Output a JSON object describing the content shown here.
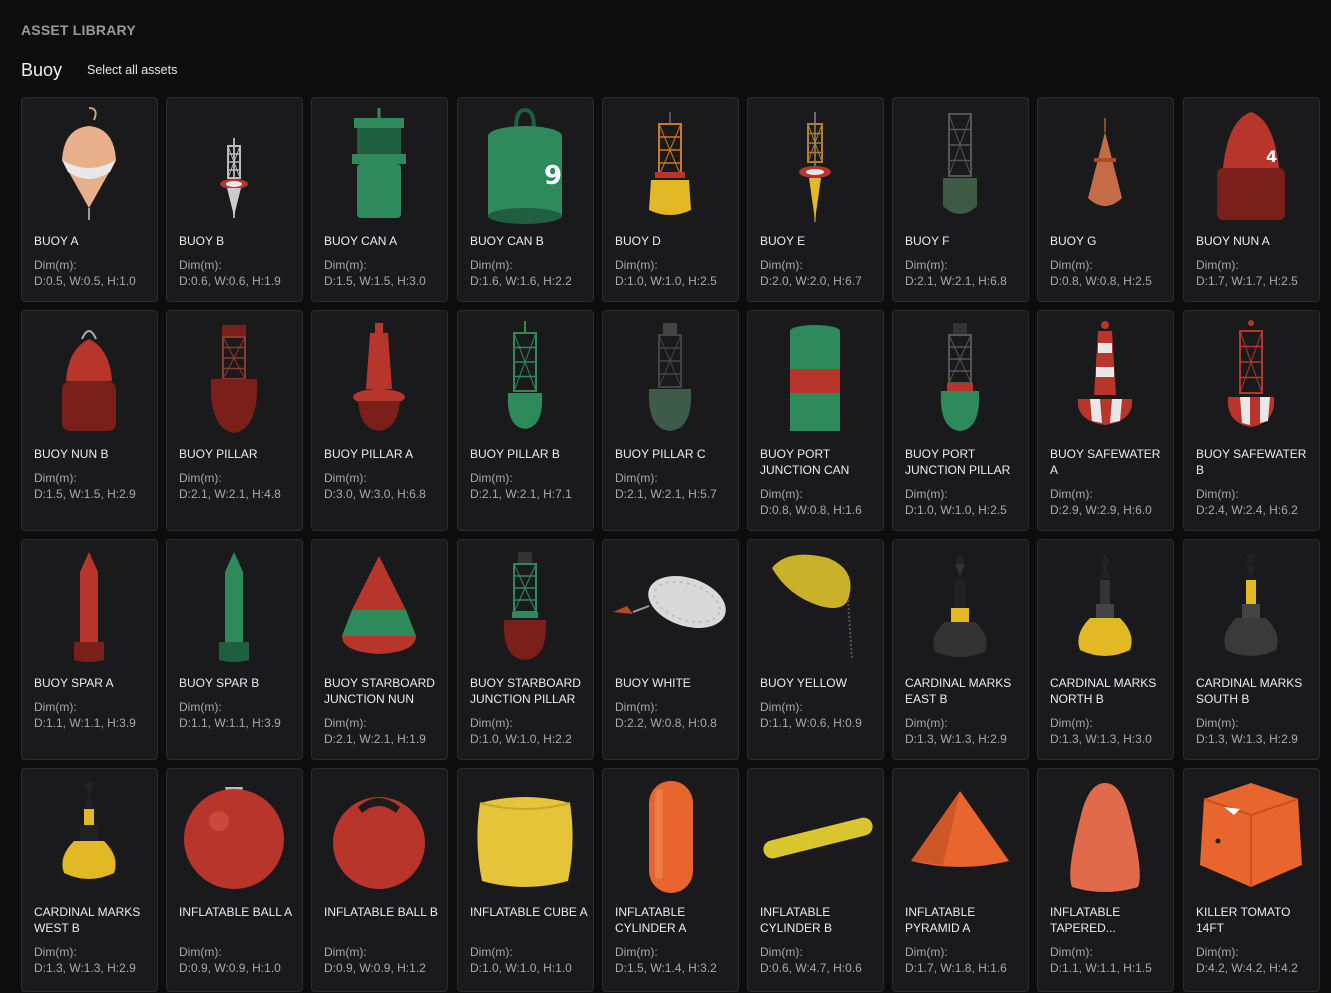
{
  "header": {
    "library_title": "ASSET LIBRARY",
    "category": "Buoy",
    "select_all": "Select all assets"
  },
  "dim_label": "Dim(m):",
  "assets": [
    {
      "name": "BUOY A",
      "dims": "D:0.5, W:0.5, H:1.0",
      "icon": "buoy-a-icon"
    },
    {
      "name": "BUOY B",
      "dims": "D:0.6, W:0.6, H:1.9",
      "icon": "buoy-b-icon"
    },
    {
      "name": "BUOY CAN A",
      "dims": "D:1.5, W:1.5, H:3.0",
      "icon": "buoy-can-a-icon"
    },
    {
      "name": "BUOY CAN B",
      "dims": "D:1.6, W:1.6, H:2.2",
      "icon": "buoy-can-b-icon"
    },
    {
      "name": "BUOY D",
      "dims": "D:1.0, W:1.0, H:2.5",
      "icon": "buoy-d-icon"
    },
    {
      "name": "BUOY E",
      "dims": "D:2.0, W:2.0, H:6.7",
      "icon": "buoy-e-icon"
    },
    {
      "name": "BUOY F",
      "dims": "D:2.1, W:2.1, H:6.8",
      "icon": "buoy-f-icon"
    },
    {
      "name": "BUOY G",
      "dims": "D:0.8, W:0.8, H:2.5",
      "icon": "buoy-g-icon"
    },
    {
      "name": "BUOY NUN A",
      "dims": "D:1.7, W:1.7, H:2.5",
      "icon": "buoy-nun-a-icon"
    },
    {
      "name": "BUOY NUN B",
      "dims": "D:1.5, W:1.5, H:2.9",
      "icon": "buoy-nun-b-icon"
    },
    {
      "name": "BUOY PILLAR",
      "dims": "D:2.1, W:2.1, H:4.8",
      "icon": "buoy-pillar-icon"
    },
    {
      "name": "BUOY PILLAR A",
      "dims": "D:3.0, W:3.0, H:6.8",
      "icon": "buoy-pillar-a-icon"
    },
    {
      "name": "BUOY PILLAR B",
      "dims": "D:2.1, W:2.1, H:7.1",
      "icon": "buoy-pillar-b-icon"
    },
    {
      "name": "BUOY PILLAR C",
      "dims": "D:2.1, W:2.1, H:5.7",
      "icon": "buoy-pillar-c-icon"
    },
    {
      "name": "BUOY PORT JUNCTION CAN",
      "dims": "D:0.8, W:0.8, H:1.6",
      "icon": "buoy-port-junction-can-icon"
    },
    {
      "name": "BUOY PORT JUNCTION PILLAR",
      "dims": "D:1.0, W:1.0, H:2.5",
      "icon": "buoy-port-junction-pillar-icon"
    },
    {
      "name": "BUOY SAFEWATER A",
      "dims": "D:2.9, W:2.9, H:6.0",
      "icon": "buoy-safewater-a-icon"
    },
    {
      "name": "BUOY SAFEWATER B",
      "dims": "D:2.4, W:2.4, H:6.2",
      "icon": "buoy-safewater-b-icon"
    },
    {
      "name": "BUOY SPAR A",
      "dims": "D:1.1, W:1.1, H:3.9",
      "icon": "buoy-spar-a-icon"
    },
    {
      "name": "BUOY SPAR B",
      "dims": "D:1.1, W:1.1, H:3.9",
      "icon": "buoy-spar-b-icon"
    },
    {
      "name": "BUOY STARBOARD JUNCTION NUN",
      "dims": "D:2.1, W:2.1, H:1.9",
      "icon": "buoy-starboard-junction-nun-icon"
    },
    {
      "name": "BUOY STARBOARD JUNCTION PILLAR",
      "dims": "D:1.0, W:1.0, H:2.2",
      "icon": "buoy-starboard-junction-pillar-icon"
    },
    {
      "name": "BUOY WHITE",
      "dims": "D:2.2, W:0.8, H:0.8",
      "icon": "buoy-white-icon"
    },
    {
      "name": "BUOY YELLOW",
      "dims": "D:1.1, W:0.6, H:0.9",
      "icon": "buoy-yellow-icon"
    },
    {
      "name": "CARDINAL MARKS EAST B",
      "dims": "D:1.3, W:1.3, H:2.9",
      "icon": "cardinal-east-icon"
    },
    {
      "name": "CARDINAL MARKS NORTH B",
      "dims": "D:1.3, W:1.3, H:3.0",
      "icon": "cardinal-north-icon"
    },
    {
      "name": "CARDINAL MARKS SOUTH B",
      "dims": "D:1.3, W:1.3, H:2.9",
      "icon": "cardinal-south-icon"
    },
    {
      "name": "CARDINAL MARKS WEST B",
      "dims": "D:1.3, W:1.3, H:2.9",
      "icon": "cardinal-west-icon"
    },
    {
      "name": "INFLATABLE BALL A",
      "dims": "D:0.9, W:0.9, H:1.0",
      "icon": "inflatable-ball-a-icon"
    },
    {
      "name": "INFLATABLE BALL B",
      "dims": "D:0.9, W:0.9, H:1.2",
      "icon": "inflatable-ball-b-icon"
    },
    {
      "name": "INFLATABLE CUBE A",
      "dims": "D:1.0, W:1.0, H:1.0",
      "icon": "inflatable-cube-icon"
    },
    {
      "name": "INFLATABLE CYLINDER A",
      "dims": "D:1.5, W:1.4, H:3.2",
      "icon": "inflatable-cylinder-a-icon"
    },
    {
      "name": "INFLATABLE CYLINDER B",
      "dims": "D:0.6, W:4.7, H:0.6",
      "icon": "inflatable-cylinder-b-icon"
    },
    {
      "name": "INFLATABLE PYRAMID A",
      "dims": "D:1.7, W:1.8, H:1.6",
      "icon": "inflatable-pyramid-icon"
    },
    {
      "name": "INFLATABLE TAPERED...",
      "dims": "D:1.1, W:1.1, H:1.5",
      "icon": "inflatable-tapered-icon"
    },
    {
      "name": "KILLER TOMATO 14FT",
      "dims": "D:4.2, W:4.2, H:4.2",
      "icon": "killer-tomato-icon"
    }
  ]
}
